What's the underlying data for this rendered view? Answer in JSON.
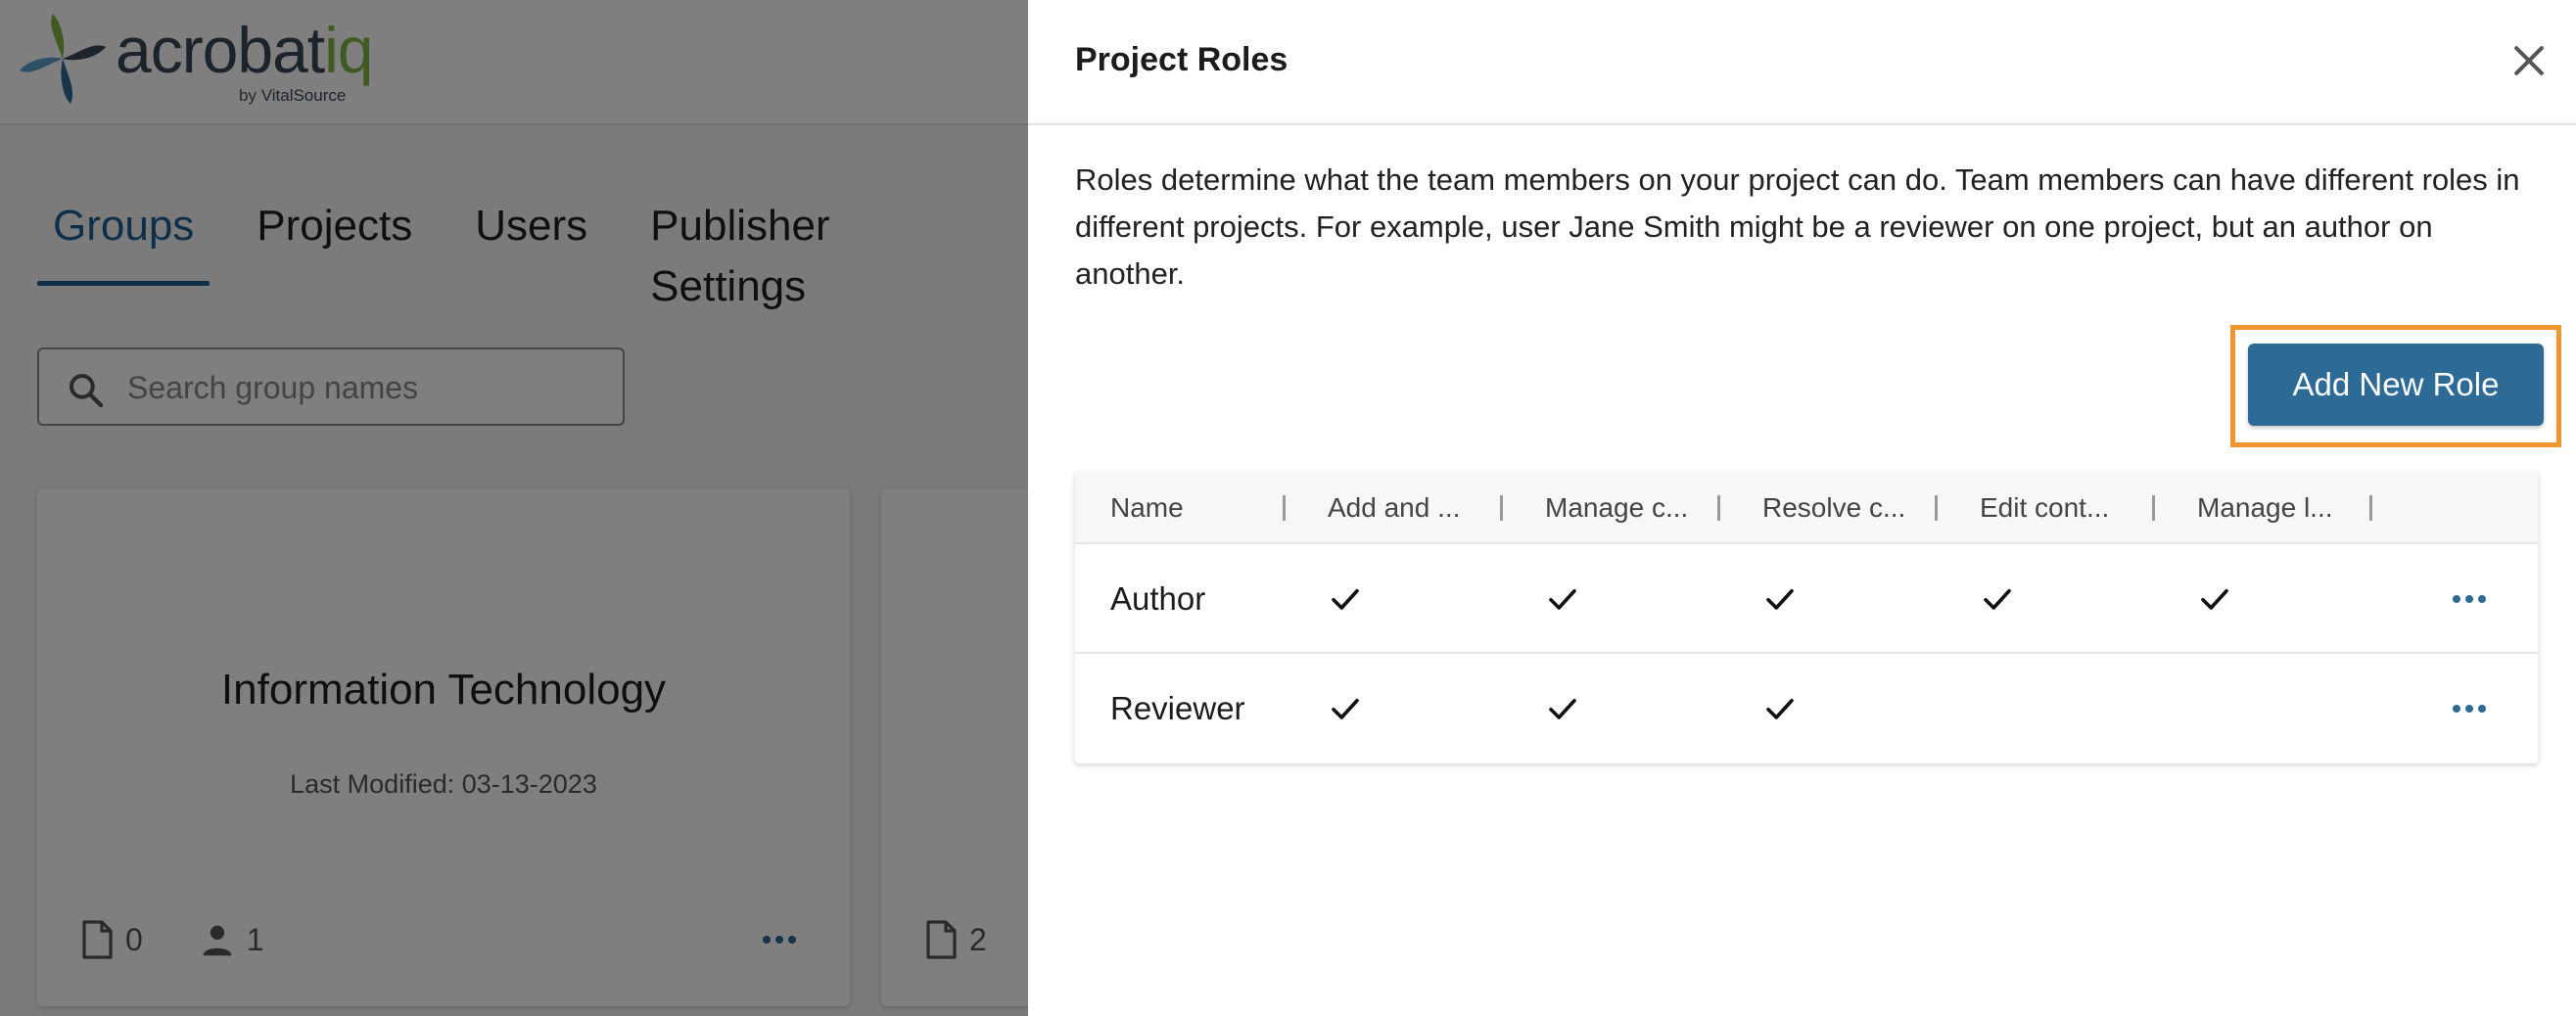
{
  "app": {
    "logo": {
      "word_dark": "acrobat",
      "word_green": "iq",
      "byline_prefix": "by",
      "byline_brand": "VitalSource"
    },
    "tabs": [
      {
        "label": "Groups",
        "active": true
      },
      {
        "label": "Projects",
        "active": false
      },
      {
        "label": "Users",
        "active": false
      },
      {
        "label": "Publisher Settings",
        "active": false
      }
    ],
    "search": {
      "placeholder": "Search group names",
      "value": ""
    },
    "cards": [
      {
        "title": "Information Technology",
        "modified": "Last Modified: 03-13-2023",
        "documents": "0",
        "users": "1"
      },
      {
        "documents": "2"
      }
    ]
  },
  "drawer": {
    "title": "Project Roles",
    "description": "Roles determine what the team members on your project can do. Team members can have different roles in different projects. For example, user Jane Smith might be a reviewer on one project, but an author on another.",
    "add_button": "Add New Role",
    "table": {
      "columns": [
        "Name",
        "Add and ...",
        "Manage c...",
        "Resolve c...",
        "Edit cont...",
        "Manage l..."
      ],
      "rows": [
        {
          "name": "Author",
          "checks": [
            true,
            true,
            true,
            true,
            true
          ]
        },
        {
          "name": "Reviewer",
          "checks": [
            true,
            true,
            true,
            false,
            false
          ]
        }
      ]
    }
  },
  "colors": {
    "primary": "#2d6a96",
    "tab_active": "#1f5e90",
    "highlight": "#f0962c",
    "logo_green": "#82b545",
    "logo_dark": "#3a4656",
    "icon_blue": "#2d6a96"
  },
  "icons": [
    "search-icon",
    "close-icon",
    "check-icon",
    "more-horizontal-icon",
    "document-icon",
    "person-icon"
  ]
}
